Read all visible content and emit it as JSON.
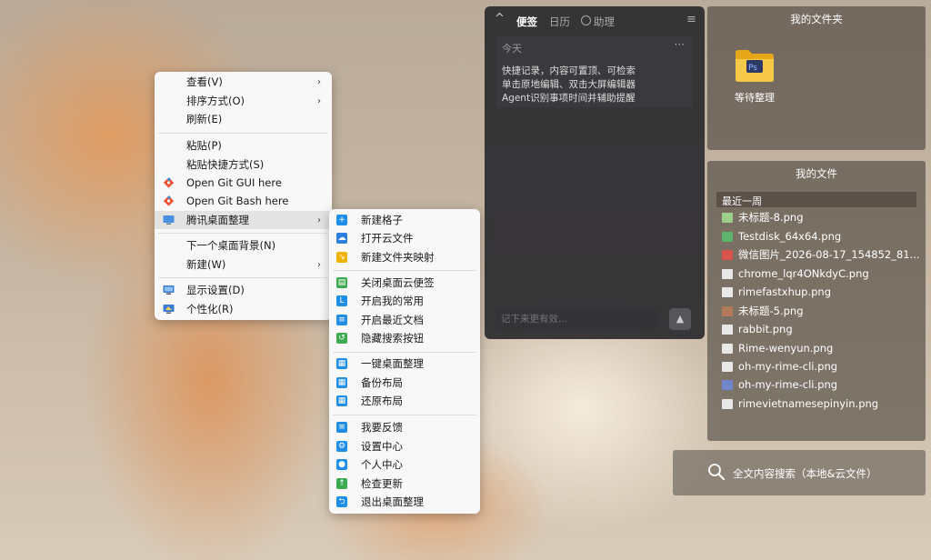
{
  "context_menu": {
    "items": [
      {
        "label": "查看(V)",
        "arrow": "›"
      },
      {
        "label": "排序方式(O)",
        "arrow": "›"
      },
      {
        "label": "刷新(E)"
      },
      {
        "label": "粘贴(P)"
      },
      {
        "label": "粘贴快捷方式(S)"
      },
      {
        "label": "Open Git GUI here"
      },
      {
        "label": "Open Git Bash here"
      },
      {
        "label": "腾讯桌面整理",
        "arrow": "›"
      },
      {
        "label": "下一个桌面背景(N)"
      },
      {
        "label": "新建(W)",
        "arrow": "›"
      },
      {
        "label": "显示设置(D)"
      },
      {
        "label": "个性化(R)"
      }
    ]
  },
  "submenu": {
    "items": [
      {
        "label": "新建格子",
        "icon": "plus-icon",
        "color": "#1e8ee8"
      },
      {
        "label": "打开云文件",
        "icon": "cloud-icon",
        "color": "#2d7fe0"
      },
      {
        "label": "新建文件夹映射",
        "icon": "folder-link-icon",
        "color": "#f0b400"
      },
      {
        "label": "关闭桌面云便签",
        "icon": "note-icon",
        "color": "#3caa50"
      },
      {
        "label": "开启我的常用",
        "icon": "star-list-icon",
        "color": "#1e8ee8"
      },
      {
        "label": "开启最近文档",
        "icon": "document-icon",
        "color": "#1e8ee8"
      },
      {
        "label": "隐藏搜索按钮",
        "icon": "hide-icon",
        "color": "#3caa50"
      },
      {
        "label": "一键桌面整理",
        "icon": "grid-icon",
        "color": "#1e8ee8"
      },
      {
        "label": "备份布局",
        "icon": "backup-icon",
        "color": "#1e8ee8"
      },
      {
        "label": "还原布局",
        "icon": "restore-icon",
        "color": "#1e8ee8"
      },
      {
        "label": "我要反馈",
        "icon": "feedback-icon",
        "color": "#1e8ee8"
      },
      {
        "label": "设置中心",
        "icon": "settings-icon",
        "color": "#1e8ee8"
      },
      {
        "label": "个人中心",
        "icon": "user-icon",
        "color": "#1e8ee8"
      },
      {
        "label": "检查更新",
        "icon": "update-icon",
        "color": "#3caa50"
      },
      {
        "label": "退出桌面整理",
        "icon": "exit-icon",
        "color": "#1e8ee8"
      }
    ]
  },
  "notes_panel": {
    "collapse_icon": "^",
    "tabs": [
      "便签",
      "日历",
      "助理"
    ],
    "active_tab": "便签",
    "menu_icon": "≡",
    "note": {
      "date": "今天",
      "more": "···",
      "lines": [
        "快捷记录，内容可置顶、可检索",
        "单击原地编辑、双击大屏编辑器",
        "Agent识别事项时间并辅助提醒"
      ]
    },
    "input_placeholder": "记下来更有效...",
    "send_icon": "▲"
  },
  "folder_panel": {
    "title": "我的文件夹",
    "folder_name": "等待整理"
  },
  "files_panel": {
    "title": "我的文件",
    "section": "最近一周",
    "files": [
      "未标题-8.png",
      "Testdisk_64x64.png",
      "微信图片_2026-08-17_154852_81...",
      "chrome_lqr4ONkdyC.png",
      "rimefastxhup.png",
      "未标题-5.png",
      "rabbit.png",
      "Rime-wenyun.png",
      "oh-my-rime-cli.png",
      "oh-my-rime-cli.png",
      "rimevietnamesepinyin.png"
    ]
  },
  "search_bar": {
    "label": "全文内容搜索（本地&云文件）"
  }
}
